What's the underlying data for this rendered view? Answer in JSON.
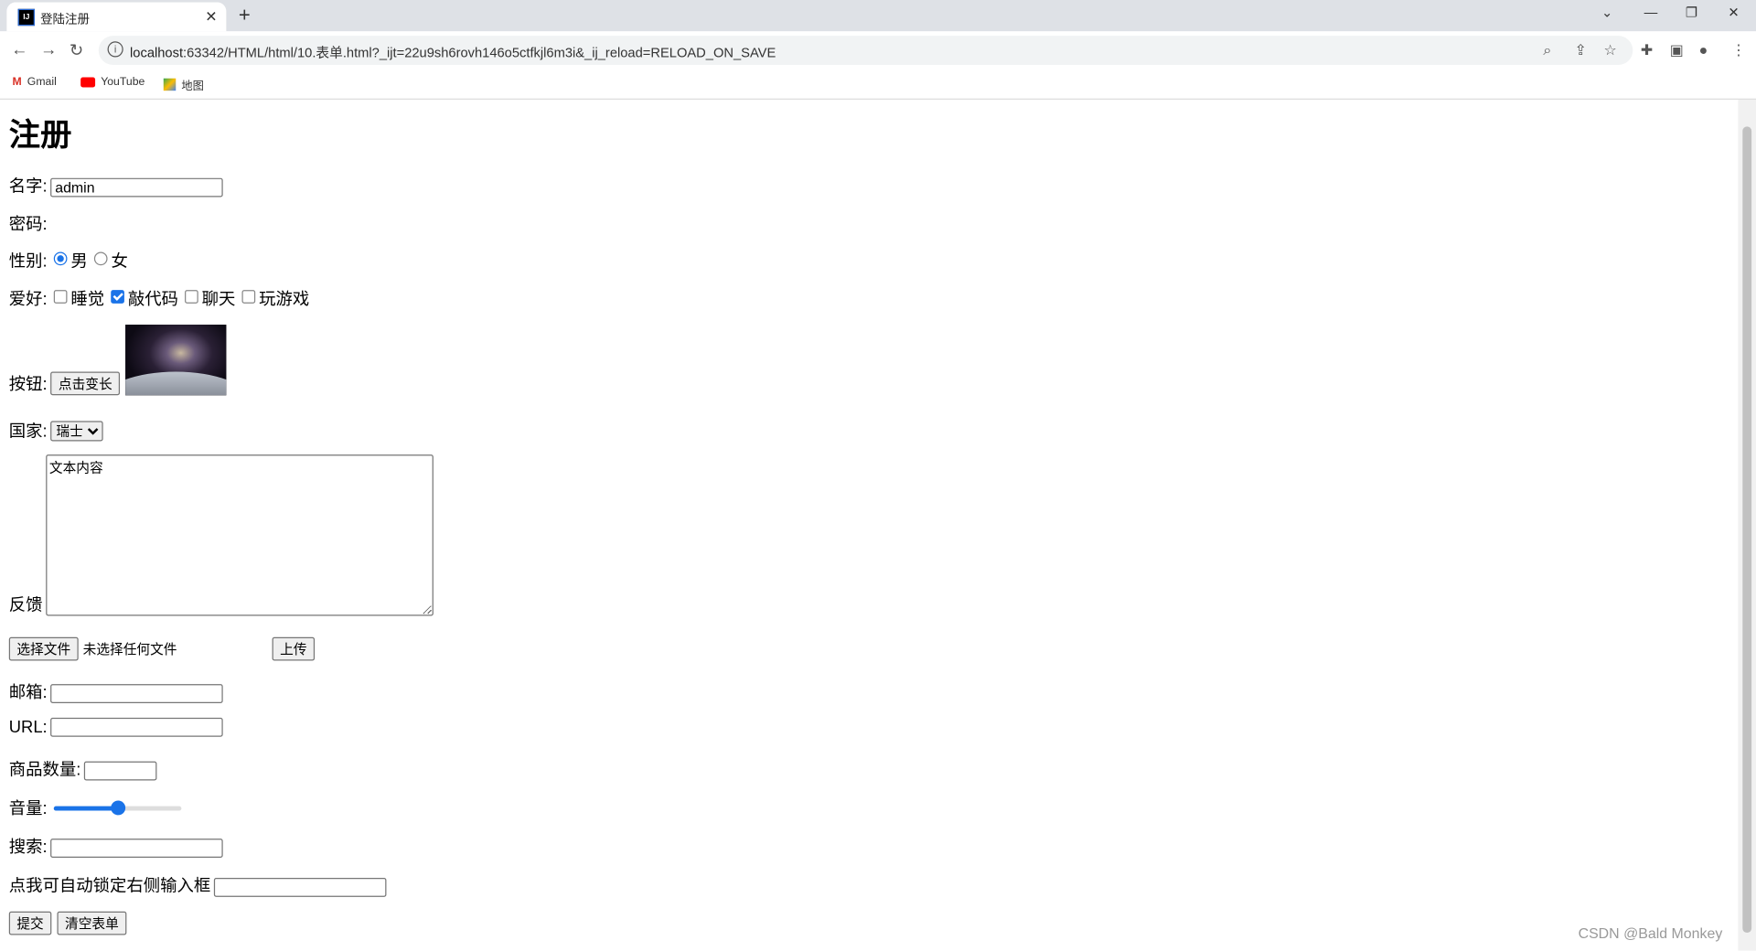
{
  "browser": {
    "tab_title": "登陆注册",
    "favicon_text": "IJ",
    "url_host": "localhost",
    "url_rest": ":63342/HTML/html/10.表单.html?_ijt=22u9sh6rovh146o5ctfkjl6m3i&_ij_reload=RELOAD_ON_SAVE",
    "bookmarks": [
      {
        "label": "Gmail",
        "icon": "gmail-icon"
      },
      {
        "label": "YouTube",
        "icon": "youtube-icon"
      },
      {
        "label": "地图",
        "icon": "maps-icon"
      }
    ]
  },
  "form": {
    "title": "注册",
    "name_label": "名字:",
    "name_value": "admin",
    "password_label": "密码:",
    "gender_label": "性别:",
    "gender_options": [
      "男",
      "女"
    ],
    "gender_selected": "男",
    "hobby_label": "爱好:",
    "hobbies": [
      {
        "label": "睡觉",
        "checked": false
      },
      {
        "label": "敲代码",
        "checked": true
      },
      {
        "label": "聊天",
        "checked": false
      },
      {
        "label": "玩游戏",
        "checked": false
      }
    ],
    "button_label": "按钮:",
    "button_text": "点击变长",
    "country_label": "国家:",
    "country_value": "瑞士",
    "feedback_label": "反馈",
    "feedback_value": "文本内容",
    "file_button": "选择文件",
    "file_status": "未选择任何文件",
    "upload_button": "上传",
    "email_label": "邮箱:",
    "url_label": "URL:",
    "quantity_label": "商品数量:",
    "volume_label": "音量:",
    "volume_percent": 50,
    "search_label": "搜索:",
    "focus_label": "点我可自动锁定右侧输入框",
    "submit": "提交",
    "reset": "清空表单"
  },
  "watermark": "CSDN @Bald Monkey",
  "colors": {
    "accent": "#1a73e8"
  }
}
